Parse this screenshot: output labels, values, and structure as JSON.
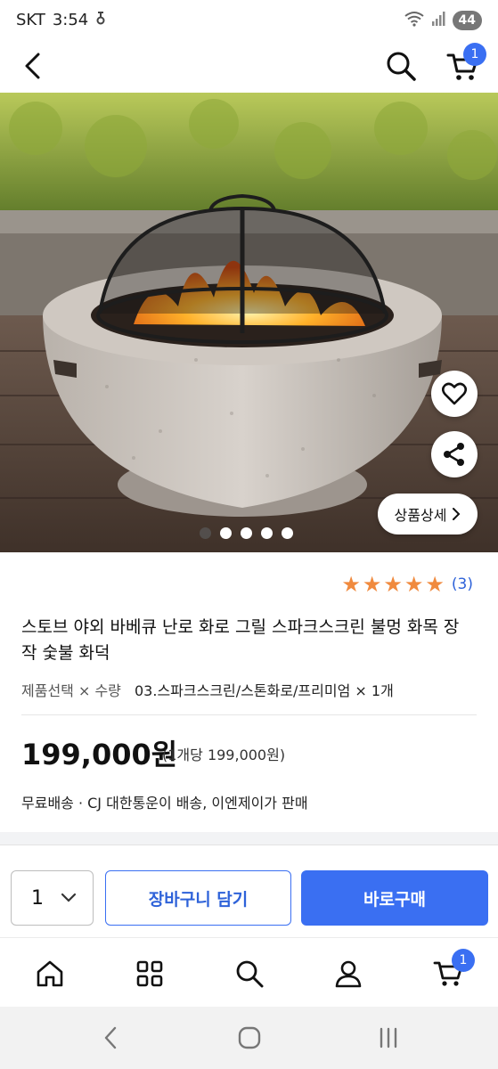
{
  "status_bar": {
    "carrier": "SKT",
    "time": "3:54",
    "battery": "44"
  },
  "header": {
    "cart_count": "1"
  },
  "gallery": {
    "detail_button_label": "상품상세",
    "active_index": 2,
    "total": 5
  },
  "product": {
    "rating_stars": 5,
    "review_count": "(3)",
    "title": "스토브 야외 바베큐 난로 화로 그릴 스파크스크린 불멍 화목 장작 숯불 화덕",
    "option_label": "제품선택 × 수량",
    "option_value": "03.스파크스크린/스톤화로/프리미엄 × 1개",
    "price": "199,000원",
    "unit_price": "(1개당 199,000원)",
    "shipping": "무료배송 ·  CJ 대한통운이 배송, 이엔제이가 판매"
  },
  "purchase": {
    "quantity": "1",
    "add_to_cart_label": "장바구니 담기",
    "buy_now_label": "바로구매"
  },
  "bottom_nav": {
    "cart_count": "1"
  },
  "colors": {
    "accent": "#3a6ff2",
    "star": "#f08a3e",
    "review_link": "#2e62d9"
  }
}
